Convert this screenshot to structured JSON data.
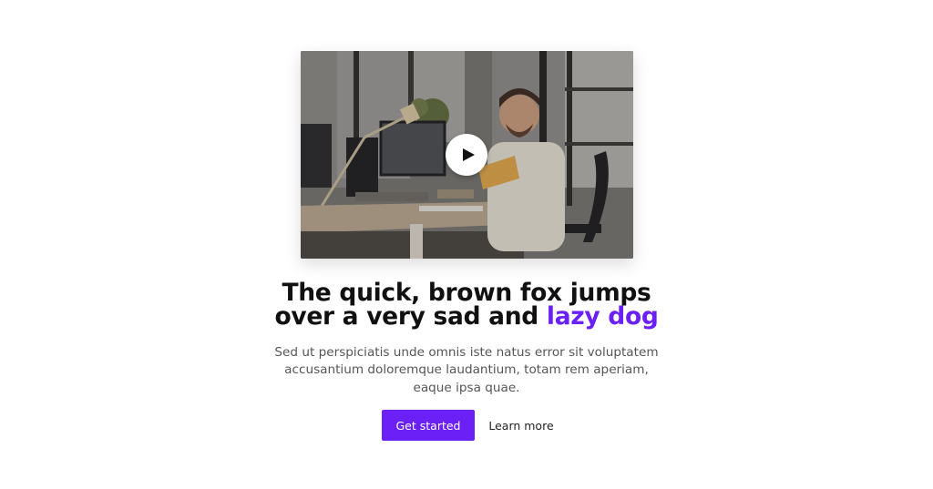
{
  "hero": {
    "video": {
      "play_icon": "play-icon",
      "background_tint": "#6e6c6a"
    },
    "headline": {
      "line1": "The quick, brown fox jumps",
      "line2_prefix": "over a very sad and ",
      "line2_accent": "lazy dog"
    },
    "subtext": "Sed ut perspiciatis unde omnis iste natus error sit voluptatem accusantium doloremque laudantium, totam rem aperiam, eaque ipsa quae.",
    "buttons": {
      "primary_label": "Get started",
      "secondary_label": "Learn more"
    }
  },
  "colors": {
    "accent": "#6b21f5",
    "heading": "#111111",
    "body_text": "#555555",
    "background": "#ffffff"
  }
}
